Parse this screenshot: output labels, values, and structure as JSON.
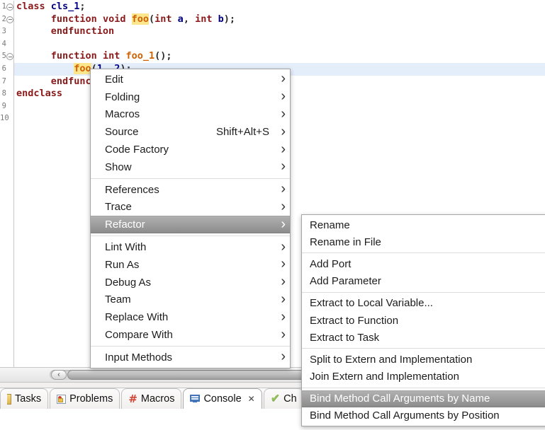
{
  "editor": {
    "line_count": 10,
    "current_line": 6,
    "fold_lines": [
      1,
      2,
      5
    ],
    "colors": {
      "keyword": "#8a1a1a",
      "class_name": "#000080",
      "function_name": "#d06000",
      "number": "#000080",
      "occurrence_highlight": "#fbe68e",
      "current_line_background": "#e4eefb",
      "line_number": "#7a7a7a",
      "menu_highlight_top": "#b0b0b0",
      "menu_highlight_bottom": "#8c8c8c"
    },
    "lines": [
      {
        "n": 1,
        "tokens": [
          [
            "kw",
            "class"
          ],
          [
            "pl",
            " "
          ],
          [
            "cls",
            "cls_1"
          ],
          [
            "pl",
            ";"
          ]
        ]
      },
      {
        "n": 2,
        "tokens": [
          [
            "pl",
            "      "
          ],
          [
            "kw",
            "function"
          ],
          [
            "pl",
            " "
          ],
          [
            "kw",
            "void"
          ],
          [
            "pl",
            " "
          ],
          [
            "fnh",
            "foo"
          ],
          [
            "pl",
            "("
          ],
          [
            "kw",
            "int"
          ],
          [
            "pl",
            " "
          ],
          [
            "var",
            "a"
          ],
          [
            "pl",
            ", "
          ],
          [
            "kw",
            "int"
          ],
          [
            "pl",
            " "
          ],
          [
            "var",
            "b"
          ],
          [
            "pl",
            ");"
          ]
        ]
      },
      {
        "n": 3,
        "tokens": [
          [
            "pl",
            "      "
          ],
          [
            "kw",
            "endfunction"
          ]
        ]
      },
      {
        "n": 4,
        "tokens": []
      },
      {
        "n": 5,
        "tokens": [
          [
            "pl",
            "      "
          ],
          [
            "kw",
            "function"
          ],
          [
            "pl",
            " "
          ],
          [
            "kw",
            "int"
          ],
          [
            "pl",
            " "
          ],
          [
            "fn",
            "foo_1"
          ],
          [
            "pl",
            "();"
          ]
        ]
      },
      {
        "n": 6,
        "tokens": [
          [
            "pl",
            "          "
          ],
          [
            "fnh",
            "foo"
          ],
          [
            "pl",
            "("
          ],
          [
            "num",
            "1"
          ],
          [
            "pl",
            ", "
          ],
          [
            "num",
            "2"
          ],
          [
            "pl",
            ");"
          ]
        ]
      },
      {
        "n": 7,
        "tokens": [
          [
            "pl",
            "      "
          ],
          [
            "kw",
            "endfunction"
          ]
        ]
      },
      {
        "n": 8,
        "tokens": [
          [
            "kw",
            "endclass"
          ]
        ]
      },
      {
        "n": 9,
        "tokens": []
      },
      {
        "n": 10,
        "tokens": []
      }
    ]
  },
  "context_menu": {
    "items": [
      {
        "label": "Edit",
        "submenu": true
      },
      {
        "label": "Folding",
        "submenu": true
      },
      {
        "label": "Macros",
        "submenu": true
      },
      {
        "label": "Source",
        "shortcut": "Shift+Alt+S",
        "submenu": true
      },
      {
        "label": "Code Factory",
        "submenu": true
      },
      {
        "label": "Show",
        "submenu": true
      },
      {
        "type": "separator"
      },
      {
        "label": "References",
        "submenu": true
      },
      {
        "label": "Trace",
        "submenu": true
      },
      {
        "label": "Refactor",
        "submenu": true,
        "highlighted": true
      },
      {
        "type": "separator"
      },
      {
        "label": "Lint With",
        "submenu": true
      },
      {
        "label": "Run As",
        "submenu": true
      },
      {
        "label": "Debug As",
        "submenu": true
      },
      {
        "label": "Team",
        "submenu": true
      },
      {
        "label": "Replace With",
        "submenu": true
      },
      {
        "label": "Compare With",
        "submenu": true
      },
      {
        "type": "separator"
      },
      {
        "label": "Input Methods",
        "submenu": true
      }
    ]
  },
  "refactor_submenu": {
    "items": [
      {
        "label": "Rename"
      },
      {
        "label": "Rename in File"
      },
      {
        "type": "separator"
      },
      {
        "label": "Add Port"
      },
      {
        "label": "Add Parameter"
      },
      {
        "type": "separator"
      },
      {
        "label": "Extract to Local Variable..."
      },
      {
        "label": "Extract to Function"
      },
      {
        "label": "Extract to Task"
      },
      {
        "type": "separator"
      },
      {
        "label": "Split to Extern and Implementation"
      },
      {
        "label": "Join Extern and Implementation"
      },
      {
        "type": "separator"
      },
      {
        "label": "Bind Method Call Arguments by Name",
        "highlighted": true
      },
      {
        "label": "Bind Method Call Arguments by Position"
      }
    ]
  },
  "bottom_tabs": {
    "tabs": [
      {
        "label": "Tasks",
        "icon": "tasks-icon"
      },
      {
        "label": "Problems",
        "icon": "problems-icon"
      },
      {
        "label": "Macros",
        "icon": "macros-hash-icon"
      },
      {
        "label": "Console",
        "icon": "console-icon",
        "active": true,
        "closable": true
      },
      {
        "label": "Ch",
        "icon": "checks-icon"
      }
    ],
    "close_glyph": "✕"
  },
  "scrollbar": {
    "orientation": "horizontal",
    "left_arrow_glyph": "‹"
  },
  "submenu_arrow_glyph": "›"
}
